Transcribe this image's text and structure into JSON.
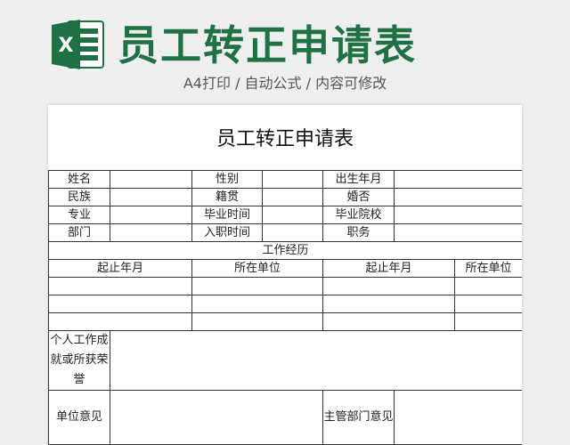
{
  "header": {
    "title": "员工转正申请表",
    "subtitle": "A4打印 / 自动公式 / 内容可修改",
    "logo_letter": "X",
    "logo_icon": "excel-icon",
    "brand_color": "#207245"
  },
  "sheet": {
    "title": "员工转正申请表",
    "basic": {
      "name": "姓名",
      "gender": "性别",
      "birth": "出生年月",
      "ethnicity": "民族",
      "native_place": "籍贯",
      "marital": "婚否",
      "major": "专业",
      "grad_time": "毕业时间",
      "school": "毕业院校",
      "department": "部门",
      "entry_time": "入职时间",
      "position": "职务"
    },
    "work_history": {
      "section_title": "工作经历",
      "col_period_1": "起止年月",
      "col_unit_1": "所在单位",
      "col_period_2": "起止年月",
      "col_unit_2": "所在单位"
    },
    "achievements_label": "个人工作成就或所获荣誉",
    "unit_opinion_label": "单位意见",
    "supervisor_opinion_label": "主管部门意见"
  }
}
